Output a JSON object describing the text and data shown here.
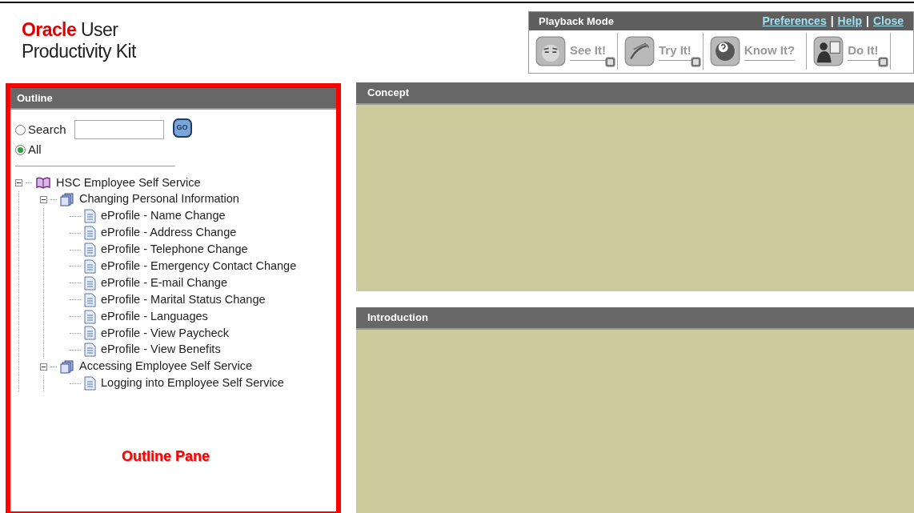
{
  "logo": {
    "brand": "Oracle",
    "line_1": "User",
    "line_2": "Productivity Kit"
  },
  "playback": {
    "title": "Playback Mode",
    "links": [
      "Preferences",
      "Help",
      "Close"
    ],
    "separators": [
      "|",
      "|"
    ],
    "modes": [
      {
        "label": "See It!",
        "kind": "see",
        "badge": true
      },
      {
        "label": "Try It!",
        "kind": "try",
        "badge": true
      },
      {
        "label": "Know It?",
        "kind": "know",
        "badge": false
      },
      {
        "label": "Do It!",
        "kind": "do",
        "badge": true
      }
    ]
  },
  "outline": {
    "title": "Outline",
    "search_options": [
      {
        "label": "Search",
        "selected": false
      },
      {
        "label": "All",
        "selected": true
      }
    ],
    "go_button": "GO",
    "tree": [
      {
        "label": "HSC Employee Self Service",
        "kind": "book",
        "expanded": true,
        "children": [
          {
            "label": "Changing Personal Information",
            "kind": "module",
            "expanded": true,
            "children": [
              {
                "label": "eProfile - Name Change",
                "kind": "topic"
              },
              {
                "label": "eProfile - Address Change",
                "kind": "topic"
              },
              {
                "label": "eProfile - Telephone Change",
                "kind": "topic"
              },
              {
                "label": "eProfile - Emergency Contact Change",
                "kind": "topic"
              },
              {
                "label": "eProfile - E-mail Change",
                "kind": "topic"
              },
              {
                "label": "eProfile - Marital Status Change",
                "kind": "topic"
              },
              {
                "label": "eProfile - Languages",
                "kind": "topic"
              },
              {
                "label": "eProfile - View Paycheck",
                "kind": "topic"
              },
              {
                "label": "eProfile - View Benefits",
                "kind": "topic"
              }
            ]
          },
          {
            "label": "Accessing Employee Self Service",
            "kind": "module",
            "expanded": true,
            "children": [
              {
                "label": "Logging into Employee Self Service",
                "kind": "topic"
              }
            ]
          }
        ]
      }
    ],
    "annotation": "Outline Pane"
  },
  "panels": [
    {
      "title": "Concept"
    },
    {
      "title": "Introduction"
    }
  ]
}
